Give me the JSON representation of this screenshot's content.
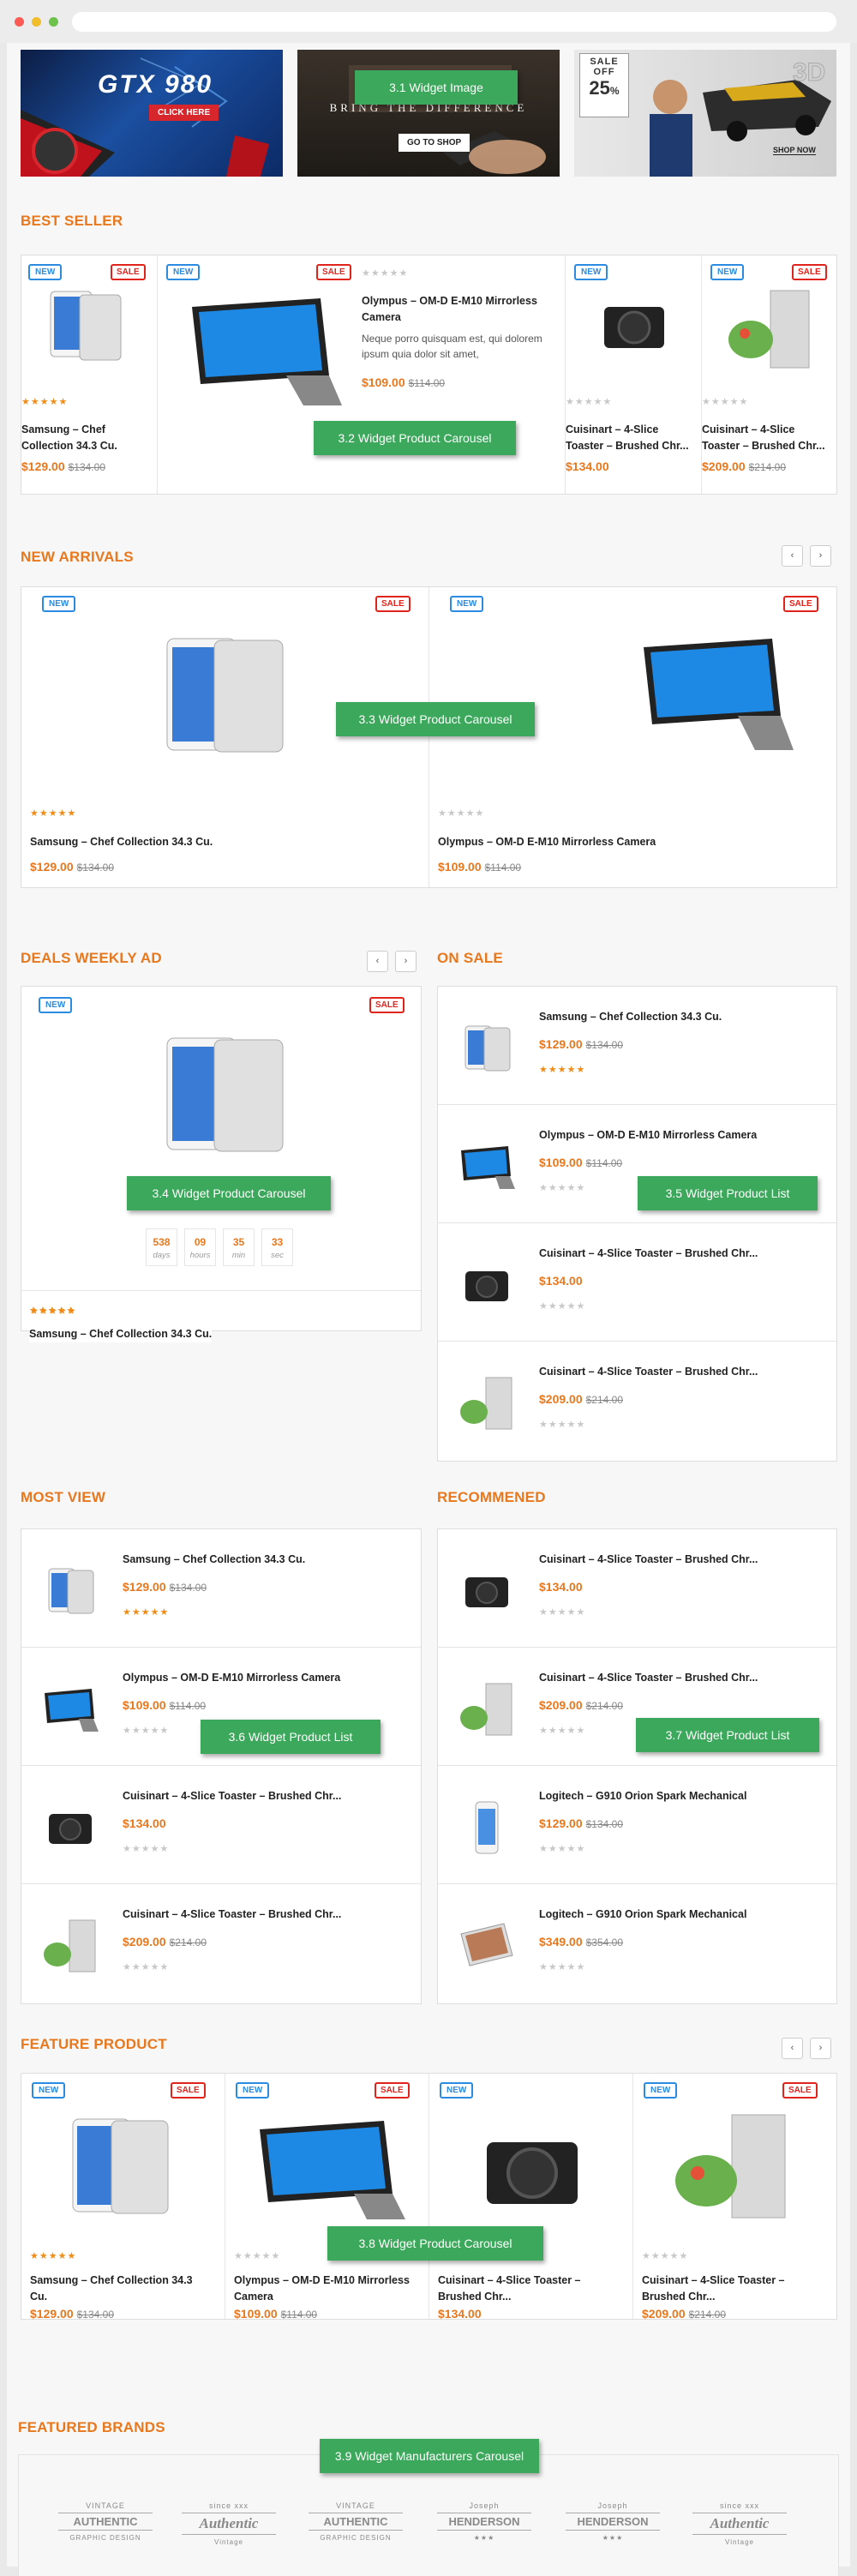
{
  "banners": [
    {
      "title": "GTX 980",
      "button": "CLICK HERE"
    },
    {
      "overlay_text": "BRING THE DIFFERENCE",
      "button": "GO TO SHOP"
    },
    {
      "tag_line1": "SALE",
      "tag_line2": "OFF",
      "tag_percent": "25",
      "tag_percent_sign": "%",
      "badge": "3D",
      "button": "SHOP NOW"
    }
  ],
  "widget_labels": {
    "w31": "3.1 Widget Image",
    "w32": "3.2 Widget Product Carousel",
    "w33": "3.3 Widget Product Carousel",
    "w34": "3.4 Widget Product Carousel",
    "w35": "3.5 Widget  Product List",
    "w36": "3.6 Widget  Product List",
    "w37": "3.7 Widget  Product List",
    "w38": "3.8 Widget  Product Carousel",
    "w39": "3.9 Widget Manufacturers Carousel"
  },
  "badges": {
    "new": "NEW",
    "sale": "SALE"
  },
  "stars": {
    "full": "★★★★★",
    "empty": "★★★★★"
  },
  "nav": {
    "prev": "‹",
    "next": "›"
  },
  "sections": {
    "best_seller": "BEST SELLER",
    "new_arrivals": "NEW ARRIVALS",
    "deals_weekly": "DEALS WEEKLY AD",
    "on_sale": "ON SALE",
    "most_view": "MOST VIEW",
    "recommended": "RECOMMENED",
    "feature_product": "FEATURE PRODUCT",
    "featured_brands": "FEATURED BRANDS"
  },
  "best_seller": {
    "p1": {
      "name": "Samsung – Chef Collection 34.3 Cu.",
      "price": "$129.00",
      "old": "$134.00"
    },
    "p2": {
      "name": "Olympus – OM-D E-M10 Mirrorless Camera",
      "desc": "Neque porro quisquam est, qui dolorem ipsum quia dolor sit amet,",
      "price": "$109.00",
      "old": "$114.00"
    },
    "p3": {
      "name": "Cuisinart – 4-Slice Toaster – Brushed Chr...",
      "price": "$134.00"
    },
    "p4": {
      "name": "Cuisinart – 4-Slice Toaster – Brushed Chr...",
      "price": "$209.00",
      "old": "$214.00"
    }
  },
  "new_arrivals": {
    "p1": {
      "name": "Samsung – Chef Collection 34.3 Cu.",
      "price": "$129.00",
      "old": "$134.00"
    },
    "p2": {
      "name": "Olympus – OM-D E-M10 Mirrorless Camera",
      "price": "$109.00",
      "old": "$114.00"
    }
  },
  "deals": {
    "name": "Samsung – Chef Collection 34.3 Cu.",
    "price": "$129.00",
    "old": "$134.00",
    "countdown": [
      {
        "value": "538",
        "unit": "days"
      },
      {
        "value": "09",
        "unit": "hours"
      },
      {
        "value": "35",
        "unit": "min"
      },
      {
        "value": "33",
        "unit": "sec"
      }
    ]
  },
  "on_sale": [
    {
      "name": "Samsung – Chef Collection 34.3 Cu.",
      "price": "$129.00",
      "old": "$134.00"
    },
    {
      "name": "Olympus – OM-D E-M10 Mirrorless Camera",
      "price": "$109.00",
      "old": "$114.00"
    },
    {
      "name": "Cuisinart – 4-Slice Toaster – Brushed Chr...",
      "price": "$134.00",
      "old": ""
    },
    {
      "name": "Cuisinart – 4-Slice Toaster – Brushed Chr...",
      "price": "$209.00",
      "old": "$214.00"
    }
  ],
  "most_view": [
    {
      "name": "Samsung – Chef Collection 34.3 Cu.",
      "price": "$129.00",
      "old": "$134.00"
    },
    {
      "name": "Olympus – OM-D E-M10 Mirrorless Camera",
      "price": "$109.00",
      "old": "$114.00"
    },
    {
      "name": "Cuisinart – 4-Slice Toaster – Brushed Chr...",
      "price": "$134.00",
      "old": ""
    },
    {
      "name": "Cuisinart – 4-Slice Toaster – Brushed Chr...",
      "price": "$209.00",
      "old": "$214.00"
    }
  ],
  "recommended": [
    {
      "name": "Cuisinart – 4-Slice Toaster – Brushed Chr...",
      "price": "$134.00",
      "old": ""
    },
    {
      "name": "Cuisinart – 4-Slice Toaster – Brushed Chr...",
      "price": "$209.00",
      "old": "$214.00"
    },
    {
      "name": "Logitech – G910 Orion Spark Mechanical",
      "price": "$129.00",
      "old": "$134.00"
    },
    {
      "name": "Logitech – G910 Orion Spark Mechanical",
      "price": "$349.00",
      "old": "$354.00"
    }
  ],
  "feature": {
    "p1": {
      "name": "Samsung – Chef Collection 34.3 Cu.",
      "price": "$129.00",
      "old": "$134.00"
    },
    "p2": {
      "name": "Olympus – OM-D E-M10 Mirrorless Camera",
      "price": "$109.00",
      "old": "$114.00"
    },
    "p3": {
      "name": "Cuisinart – 4-Slice Toaster – Brushed Chr...",
      "price": "$134.00"
    },
    "p4": {
      "name": "Cuisinart – 4-Slice Toaster – Brushed Chr...",
      "price": "$209.00",
      "old": "$214.00"
    }
  },
  "brands": [
    {
      "line1": "VINTAGE",
      "line2": "AUTHENTIC",
      "line3": "GRAPHIC DESIGN"
    },
    {
      "line1": "since xxx",
      "line2": "Authentic",
      "line3": "Vintage"
    },
    {
      "line1": "VINTAGE",
      "line2": "AUTHENTIC",
      "line3": "GRAPHIC DESIGN"
    },
    {
      "line1": "Joseph",
      "line2": "HENDERSON",
      "line3": "★★★"
    },
    {
      "line1": "Joseph",
      "line2": "HENDERSON",
      "line3": "★★★"
    },
    {
      "line1": "since xxx",
      "line2": "Authentic",
      "line3": "Vintage"
    }
  ]
}
